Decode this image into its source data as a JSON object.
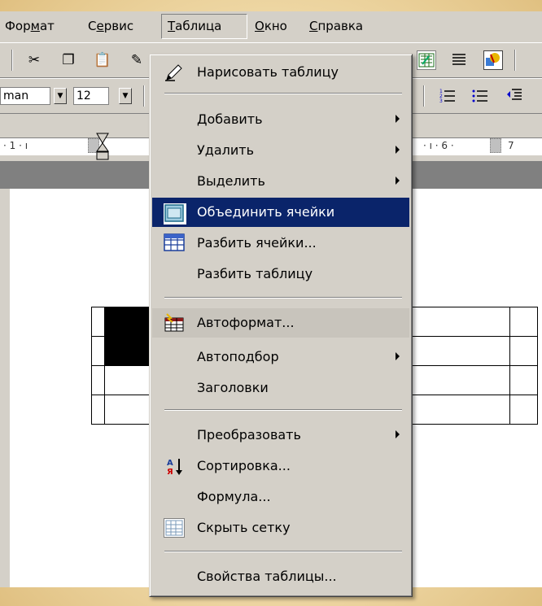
{
  "menubar": {
    "items": [
      {
        "label": "Формат",
        "hotkey": "м"
      },
      {
        "label": "Сервис",
        "hotkey": "е"
      },
      {
        "label": "Таблица",
        "hotkey": "Т"
      },
      {
        "label": "Окно",
        "hotkey": "О"
      },
      {
        "label": "Справка",
        "hotkey": "С"
      }
    ]
  },
  "formatting": {
    "font_name": "man",
    "font_size": "12"
  },
  "ruler": {
    "left_marks": "· 1 · ı",
    "right_marks": "· ı · 6 ·",
    "right_number": "7"
  },
  "menu": {
    "draw_table": "Нарисовать таблицу",
    "add": "Добавить",
    "delete": "Удалить",
    "select": "Выделить",
    "merge_cells": "Объединить ячейки",
    "split_cells": "Разбить ячейки...",
    "split_table": "Разбить таблицу",
    "autoformat": "Автоформат...",
    "autofit": "Автоподбор",
    "headings": "Заголовки",
    "convert": "Преобразовать",
    "sort": "Сортировка...",
    "formula": "Формула...",
    "hide_gridlines": "Скрыть сетку",
    "table_properties": "Свойства таблицы..."
  }
}
